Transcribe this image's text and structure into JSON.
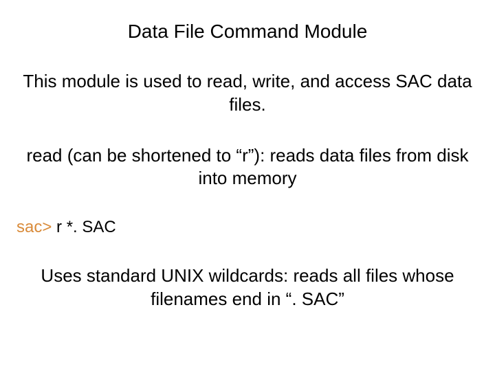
{
  "title": "Data File Command Module",
  "para1": "This module is used to read, write, and access SAC data files.",
  "para2": "read (can be shortened to “r”): reads data files from disk into memory",
  "command": {
    "prompt": "sac>",
    "text": " r   *. SAC"
  },
  "para3": "Uses standard UNIX wildcards: reads all files whose filenames end in “. SAC”"
}
